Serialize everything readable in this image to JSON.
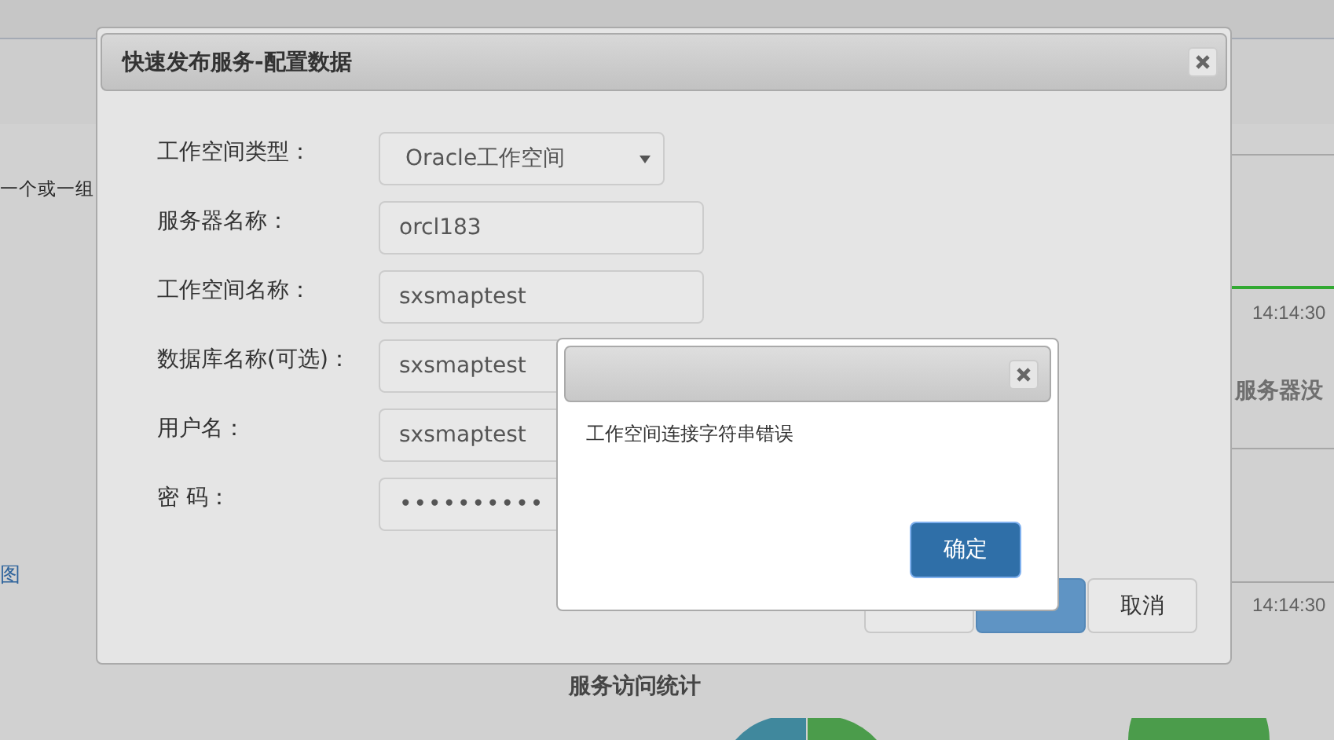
{
  "background": {
    "left_text": "一个或一组",
    "left_link": "图",
    "times": [
      "14:14:30",
      "14:14:30"
    ],
    "right_heading": "服务器没",
    "bottom_heading": "服务访问统计"
  },
  "dialog": {
    "title": "快速发布服务-配置数据",
    "fields": [
      {
        "label": "工作空间类型：",
        "kind": "select",
        "value": "Oracle工作空间"
      },
      {
        "label": "服务器名称：",
        "kind": "text",
        "value": "orcl183"
      },
      {
        "label": "工作空间名称：",
        "kind": "text",
        "value": "sxsmaptest"
      },
      {
        "label": "数据库名称(可选)：",
        "kind": "text",
        "value": "sxsmaptest"
      },
      {
        "label": "用户名：",
        "kind": "text",
        "value": "sxsmaptest"
      },
      {
        "label": "密 码：",
        "kind": "password",
        "value": "••••••••••"
      }
    ],
    "buttons": [
      {
        "kind": "default"
      },
      {
        "kind": "primary"
      },
      {
        "label": "取消",
        "kind": "default"
      }
    ]
  },
  "alert": {
    "message": "工作空间连接字符串错误",
    "button": "确定"
  }
}
